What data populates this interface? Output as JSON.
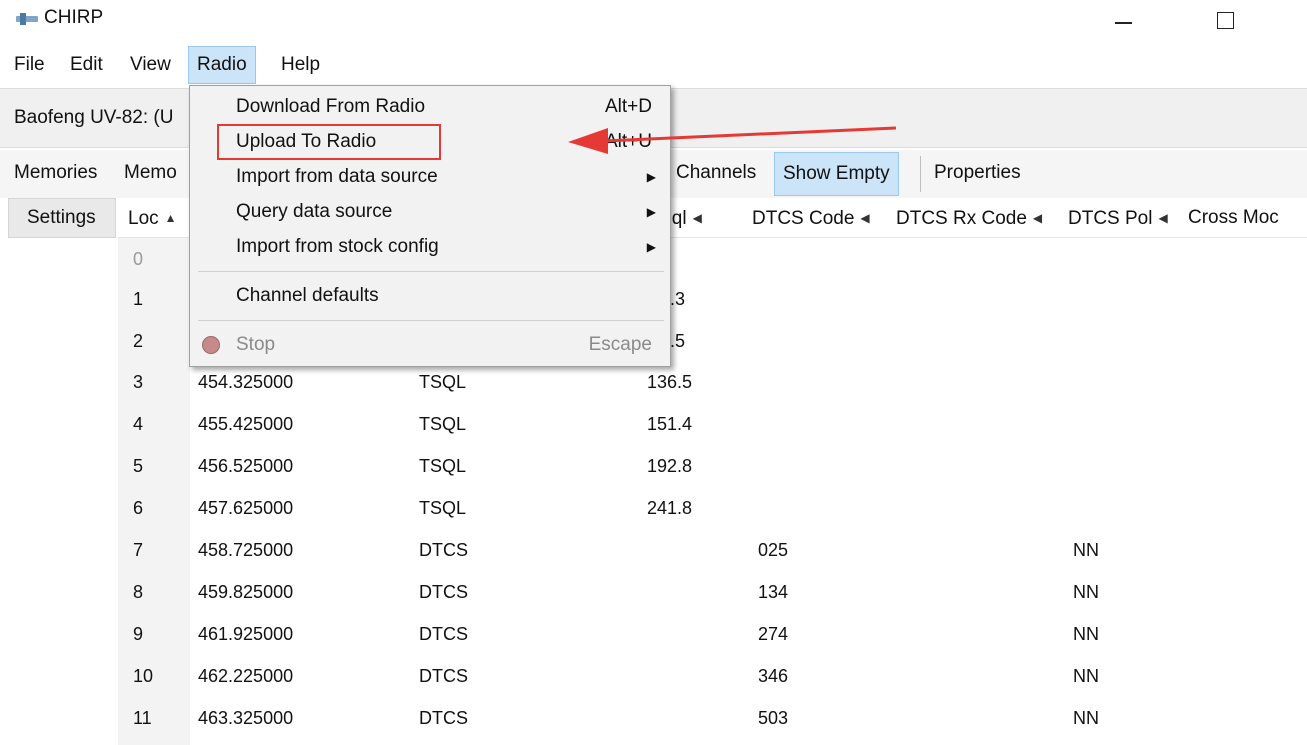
{
  "window": {
    "title": "CHIRP"
  },
  "menubar": {
    "file": "File",
    "edit": "Edit",
    "view": "View",
    "radio": "Radio",
    "help": "Help"
  },
  "radio_row": {
    "label": "Baofeng UV-82: (U"
  },
  "tabs": {
    "memories": "Memories",
    "memo": "Memo",
    "channels": "Channels",
    "show_empty": "Show Empty",
    "properties": "Properties"
  },
  "settings": "Settings",
  "headers": {
    "loc": "Loc",
    "tonesql": "neSql",
    "dtcs_code": "DTCS Code",
    "dtcs_rx_code": "DTCS Rx Code",
    "dtcs_pol": "DTCS Pol",
    "cross_mode": "Cross Moc"
  },
  "dropdown": {
    "download": {
      "label": "Download From Radio",
      "shortcut": "Alt+D"
    },
    "upload": {
      "label": "Upload To Radio",
      "shortcut": "Alt+U"
    },
    "import_ds": {
      "label": "Import from data source"
    },
    "query_ds": {
      "label": "Query data source"
    },
    "import_stock": {
      "label": "Import from stock config"
    },
    "channel_defaults": {
      "label": "Channel defaults"
    },
    "stop": {
      "label": "Stop",
      "shortcut": "Escape"
    }
  },
  "rows": [
    {
      "loc": "0",
      "freq": "",
      "mode": "",
      "tone": "",
      "dtcs": "",
      "pol": ""
    },
    {
      "loc": "1",
      "freq": "",
      "mode": "",
      "tone": ".3",
      "dtcs": "",
      "pol": ""
    },
    {
      "loc": "2",
      "freq": "",
      "mode": "",
      "tone": ".5",
      "dtcs": "",
      "pol": ""
    },
    {
      "loc": "3",
      "freq": "454.325000",
      "mode": "TSQL",
      "tone": "136.5",
      "dtcs": "",
      "pol": ""
    },
    {
      "loc": "4",
      "freq": "455.425000",
      "mode": "TSQL",
      "tone": "151.4",
      "dtcs": "",
      "pol": ""
    },
    {
      "loc": "5",
      "freq": "456.525000",
      "mode": "TSQL",
      "tone": "192.8",
      "dtcs": "",
      "pol": ""
    },
    {
      "loc": "6",
      "freq": "457.625000",
      "mode": "TSQL",
      "tone": "241.8",
      "dtcs": "",
      "pol": ""
    },
    {
      "loc": "7",
      "freq": "458.725000",
      "mode": "DTCS",
      "tone": "",
      "dtcs": "025",
      "pol": "NN"
    },
    {
      "loc": "8",
      "freq": "459.825000",
      "mode": "DTCS",
      "tone": "",
      "dtcs": "134",
      "pol": "NN"
    },
    {
      "loc": "9",
      "freq": "461.925000",
      "mode": "DTCS",
      "tone": "",
      "dtcs": "274",
      "pol": "NN"
    },
    {
      "loc": "10",
      "freq": "462.225000",
      "mode": "DTCS",
      "tone": "",
      "dtcs": "346",
      "pol": "NN"
    },
    {
      "loc": "11",
      "freq": "463.325000",
      "mode": "DTCS",
      "tone": "",
      "dtcs": "503",
      "pol": "NN"
    }
  ],
  "annotation": {
    "color": "#e53935"
  }
}
